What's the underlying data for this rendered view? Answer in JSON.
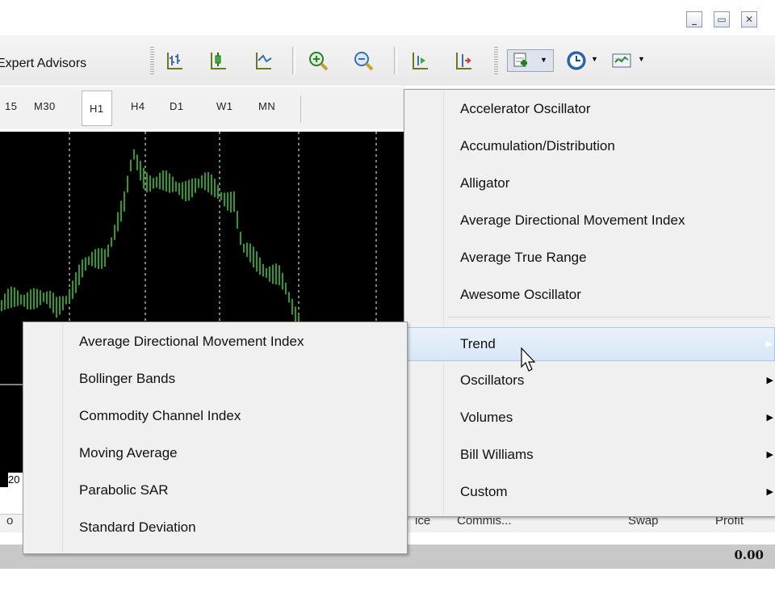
{
  "window_controls": {
    "minimize": "_",
    "restore": "▭",
    "close": "✕"
  },
  "toolbar": {
    "expert_advisors_label": "Expert Advisors"
  },
  "periods": [
    "15",
    "M30",
    "H1",
    "H4",
    "D1",
    "W1",
    "MN"
  ],
  "active_period": "H1",
  "chart": {
    "axis_label_fragment": "20",
    "candle_color": "#2f9b2f"
  },
  "terminal": {
    "headers": [
      "o",
      "ice",
      "Commis...",
      "Swap",
      "Profit"
    ],
    "profit_value": "0.00"
  },
  "indicators_menu": {
    "items": [
      "Accelerator Oscillator",
      "Accumulation/Distribution",
      "Alligator",
      "Average Directional Movement Index",
      "Average True Range",
      "Awesome Oscillator"
    ],
    "submenus": [
      "Trend",
      "Oscillators",
      "Volumes",
      "Bill Williams",
      "Custom"
    ],
    "highlighted": "Trend"
  },
  "trend_submenu": {
    "items": [
      "Average Directional Movement Index",
      "Bollinger Bands",
      "Commodity Channel Index",
      "Moving Average",
      "Parabolic SAR",
      "Standard Deviation"
    ]
  },
  "colors": {
    "menu_highlight": "#d7e6f8",
    "chart_bg": "#000000"
  }
}
